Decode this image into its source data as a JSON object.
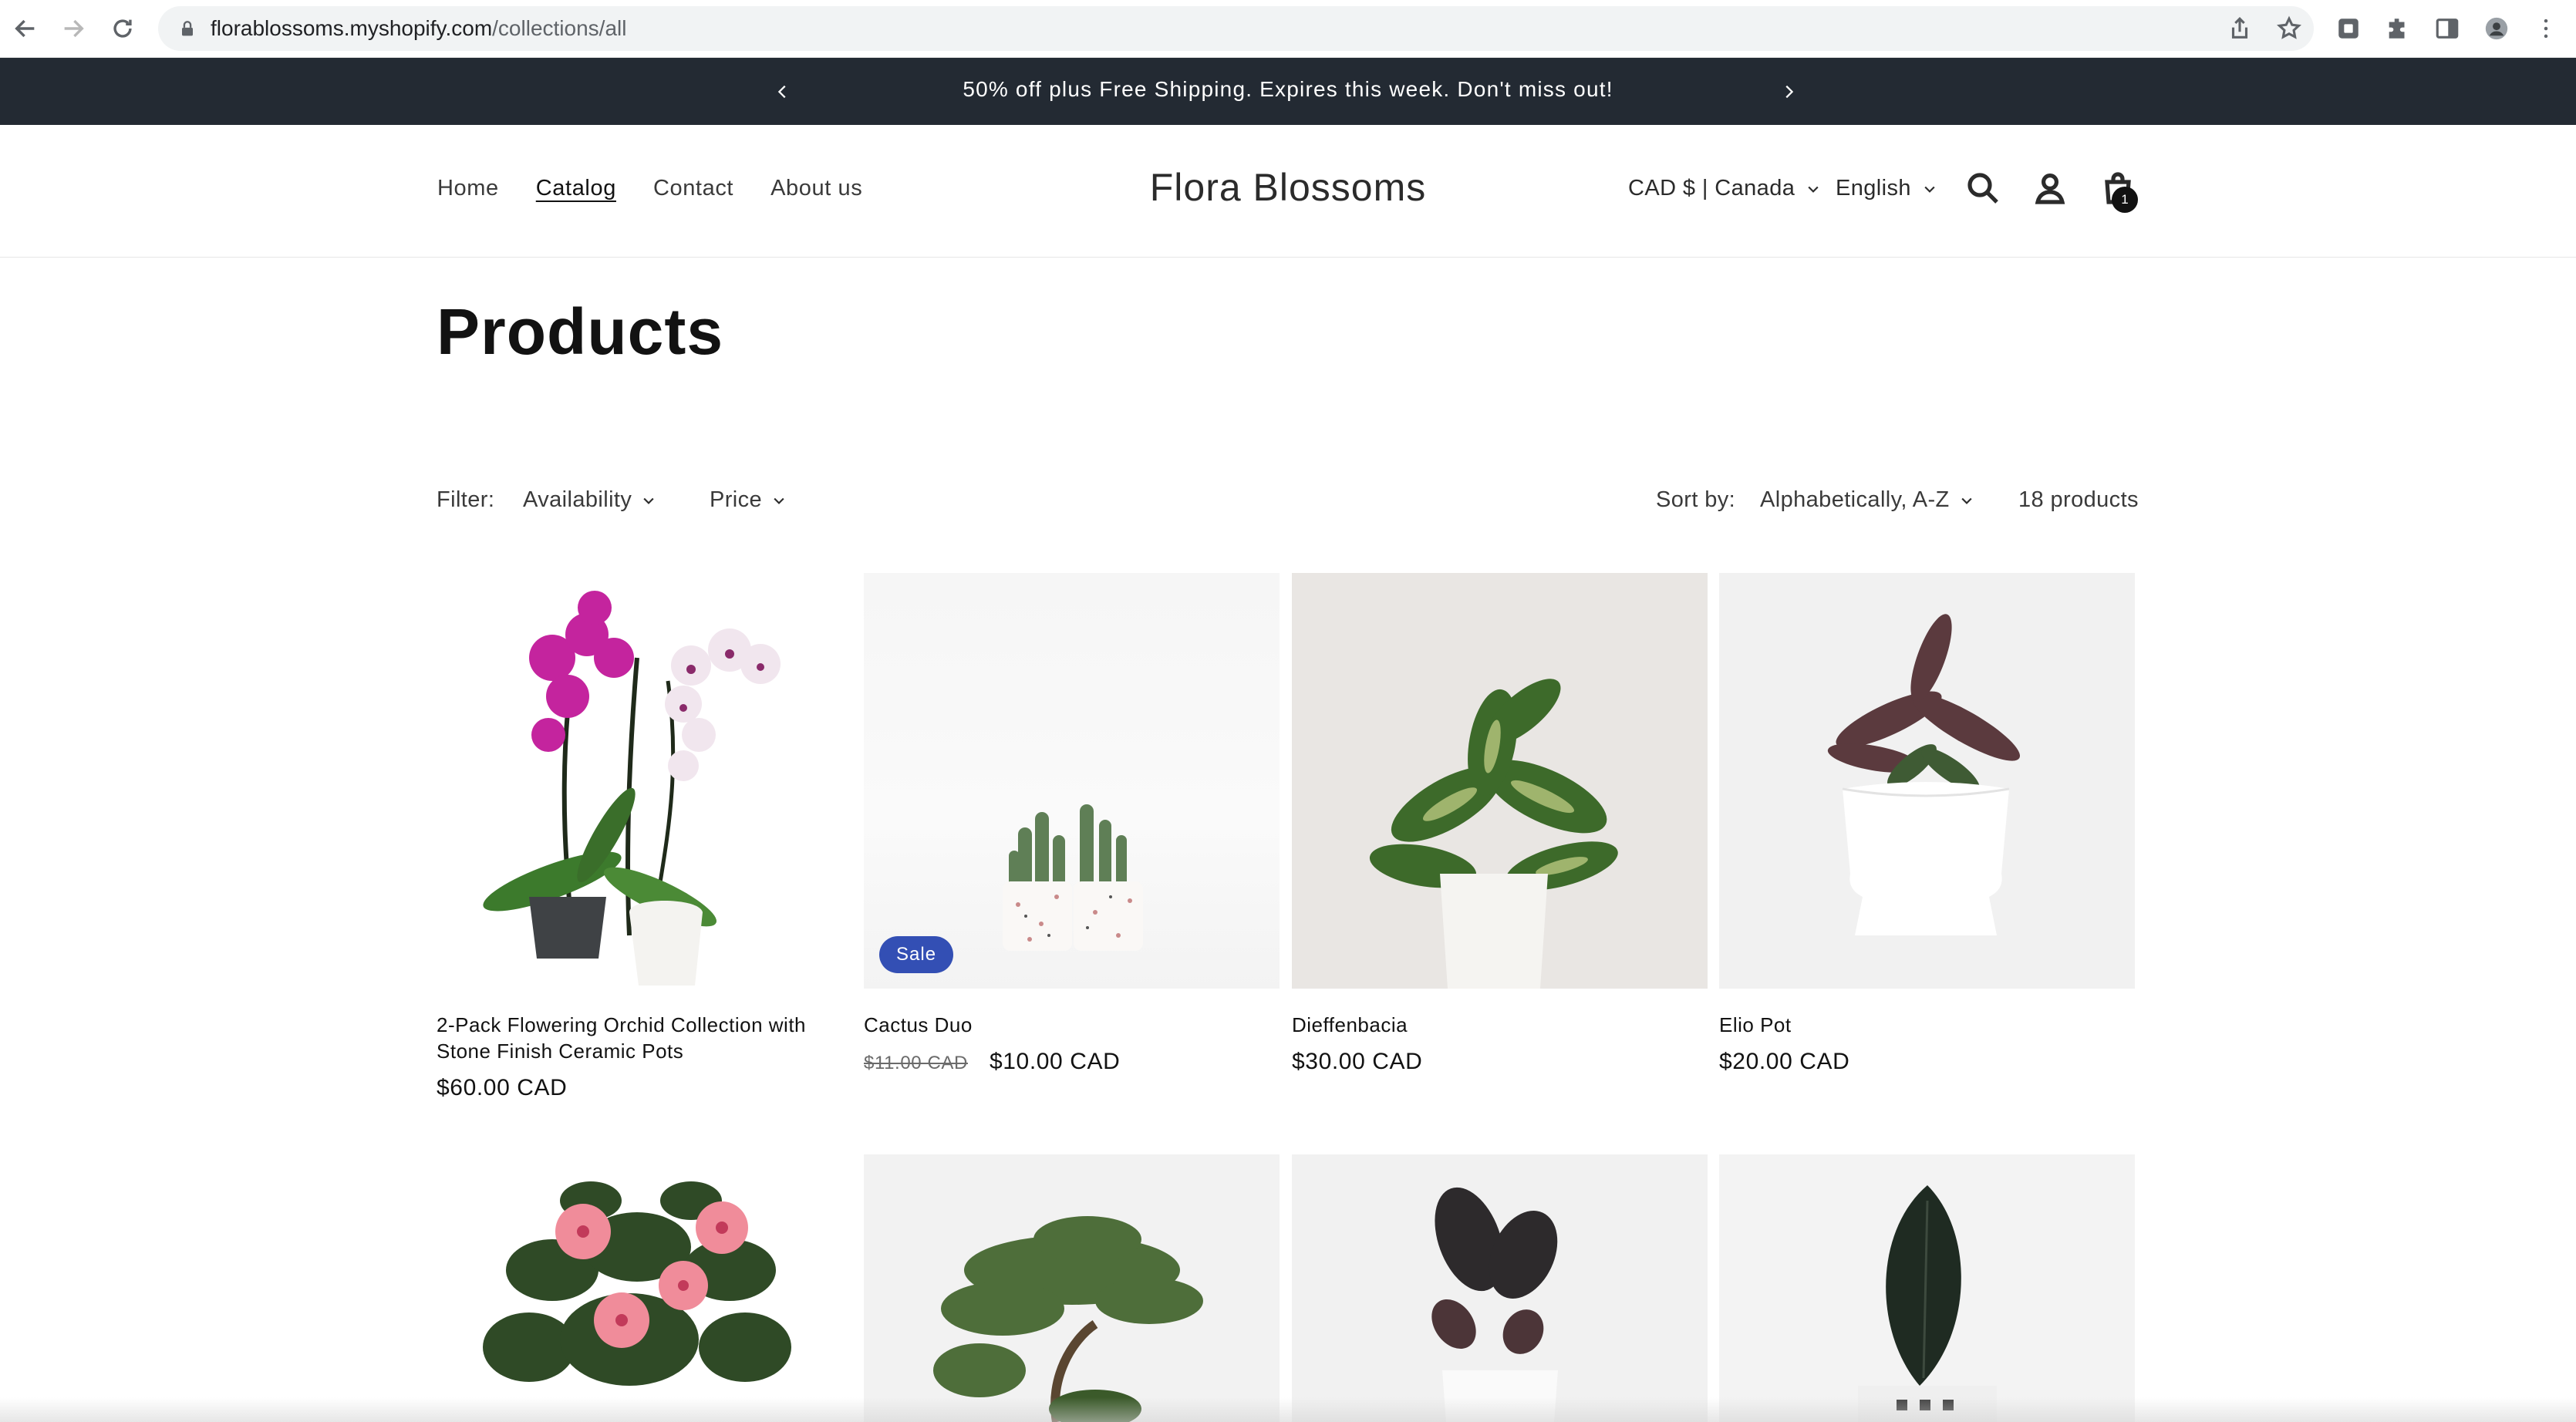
{
  "browser": {
    "url_domain": "florablossoms.myshopify.com",
    "url_path": "/collections/all"
  },
  "announcement": {
    "text": "50% off plus Free Shipping. Expires this week. Don't miss out!"
  },
  "header": {
    "menu": [
      "Home",
      "Catalog",
      "Contact",
      "About us"
    ],
    "active_menu": "Catalog",
    "logo": "Flora Blossoms",
    "currency": "CAD $ | Canada",
    "language": "English",
    "cart_count": "1"
  },
  "page": {
    "title": "Products",
    "filter_label": "Filter:",
    "filters": [
      "Availability",
      "Price"
    ],
    "sort_label": "Sort by:",
    "sort_value": "Alphabetically, A-Z",
    "product_count": "18 products"
  },
  "products": [
    {
      "title": "2-Pack Flowering Orchid Collection with Stone Finish Ceramic Pots",
      "price": "$60.00 CAD",
      "old_price": "",
      "badge": ""
    },
    {
      "title": "Cactus Duo",
      "price": "$10.00 CAD",
      "old_price": "$11.00 CAD",
      "badge": "Sale"
    },
    {
      "title": "Dieffenbacia",
      "price": "$30.00 CAD",
      "old_price": "",
      "badge": ""
    },
    {
      "title": "Elio Pot",
      "price": "$20.00 CAD",
      "old_price": "",
      "badge": ""
    }
  ],
  "colors": {
    "announcement_bg": "#232a33",
    "sale_badge": "#334fb4"
  }
}
